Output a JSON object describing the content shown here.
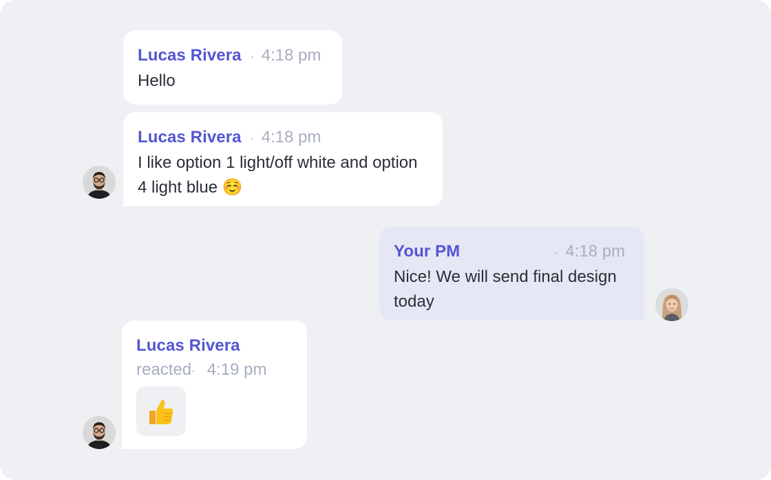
{
  "messages": [
    {
      "sender": "Lucas Rivera",
      "time": "4:18 pm",
      "text": "Hello"
    },
    {
      "sender": "Lucas Rivera",
      "time": "4:18 pm",
      "text": "I like option 1 light/off white and option 4 light blue ☺️"
    },
    {
      "sender": "Your PM",
      "time": "4:18 pm",
      "text": "Nice! We will send final design today"
    },
    {
      "sender": "Lucas Rivera",
      "action": "reacted",
      "time": "4:19 pm",
      "reaction": "👍"
    }
  ],
  "separator": "·",
  "avatars": {
    "lucas": "avatar-man-glasses-beard",
    "pm": "avatar-woman-blonde"
  },
  "colors": {
    "background": "#eff0f3",
    "incoming_bubble": "#ffffff",
    "outgoing_bubble": "#e6e7f4",
    "sender_name": "#5355d3",
    "timestamp": "#a8aec0",
    "message_text": "#2a2d36"
  }
}
